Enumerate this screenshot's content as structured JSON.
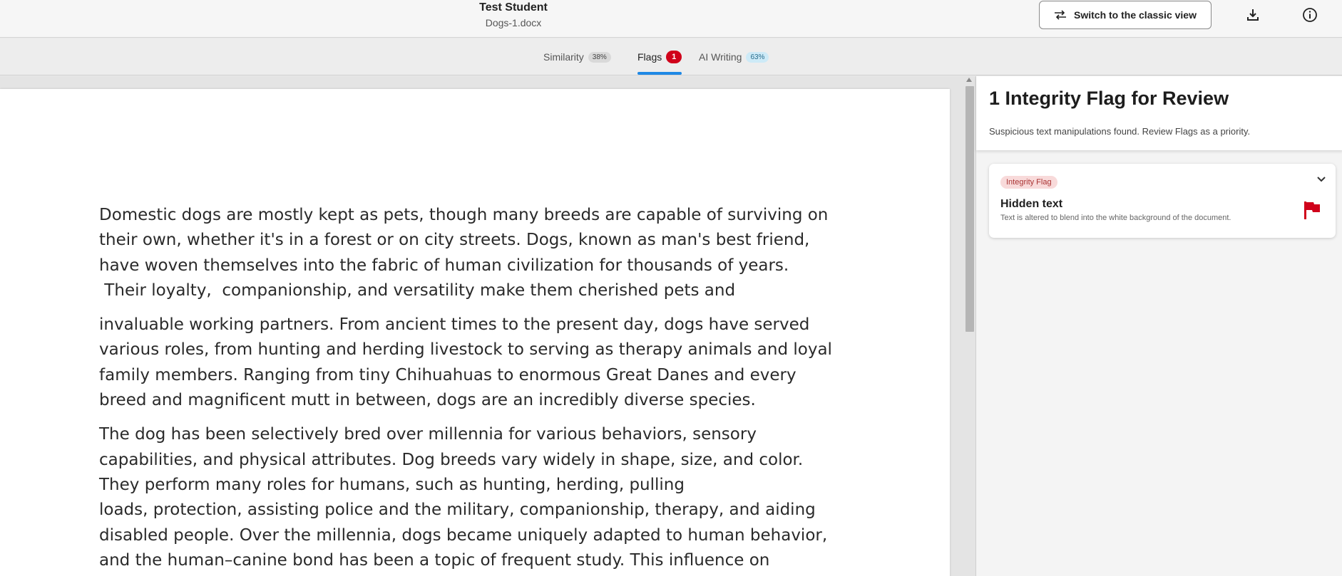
{
  "header": {
    "student": "Test Student",
    "file": "Dogs-1.docx",
    "classic_view_label": "Switch to the classic view"
  },
  "tabs": [
    {
      "label": "Similarity",
      "badge": "38%"
    },
    {
      "label": "Flags",
      "badge": "1"
    },
    {
      "label": "AI Writing",
      "badge": "63%"
    }
  ],
  "document": {
    "paragraphs": [
      [
        "Domestic dogs are mostly kept as pets,  though many breeds are capable of surviving on",
        "their own,  whether it's in a forest or on city streets.  Dogs,  known as man's best friend,",
        "have woven themselves into the fabric of human civilization for thousands of years.",
        " Their loyalty,  companionship, and versatility make them cherished pets and"
      ],
      [
        "invaluable working partners. From ancient times to the present day, dogs have served",
        "various roles, from hunting and herding livestock to serving as therapy animals and loyal",
        "family members. Ranging from tiny Chihuahuas to enormous Great Danes and every",
        "breed and magnificent mutt in between, dogs are an incredibly diverse species."
      ],
      [
        "The dog has been selectively bred over millennia for various behaviors, sensory",
        "capabilities, and physical attributes. Dog breeds vary widely in shape, size, and color.",
        "They perform many roles for humans, such as hunting, herding, pulling",
        "loads, protection, assisting police and the military, companionship, therapy, and aiding",
        "disabled people. Over the millennia, dogs became uniquely adapted to human behavior,",
        "and the human–canine bond has been a topic of frequent study. This influence on"
      ]
    ]
  },
  "panel": {
    "title": "1 Integrity Flag for Review",
    "subtitle": "Suspicious text manipulations found. Review Flags as a priority.",
    "flag": {
      "tag": "Integrity Flag",
      "name": "Hidden text",
      "description": "Text is altered to blend into the white background of the document."
    }
  },
  "colors": {
    "accent": "#1e88e5",
    "flag_red": "#d0021b"
  }
}
